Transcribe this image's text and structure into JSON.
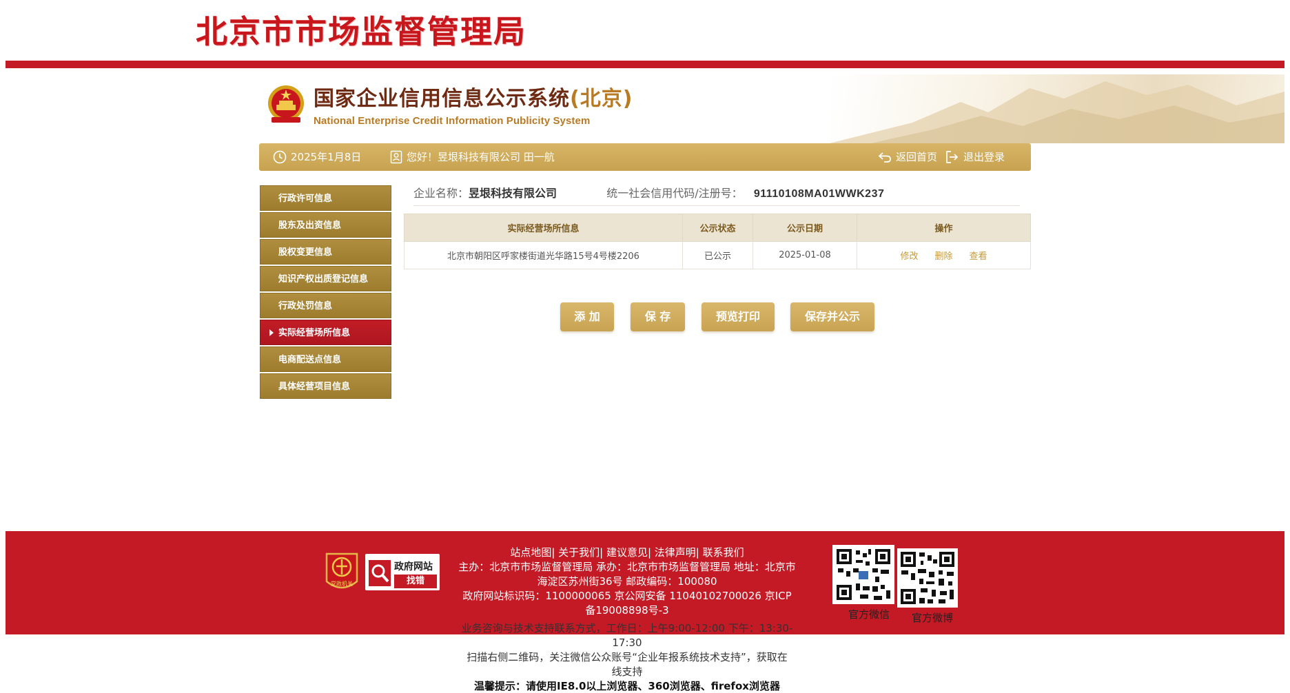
{
  "bureau": {
    "title": "北京市市场监督管理局"
  },
  "system": {
    "title_cn": "国家企业信用信息公示系统",
    "title_paren": "(北京)",
    "title_en": "National Enterprise Credit Information Publicity System"
  },
  "info_bar": {
    "date": "2025年1月8日",
    "greeting": "您好！昱垠科技有限公司  田一航",
    "home_link": "返回首页",
    "logout_link": "退出登录"
  },
  "sidebar": {
    "items": [
      {
        "label": "行政许可信息",
        "active": false
      },
      {
        "label": "股东及出资信息",
        "active": false
      },
      {
        "label": "股权变更信息",
        "active": false
      },
      {
        "label": "知识产权出质登记信息",
        "active": false
      },
      {
        "label": "行政处罚信息",
        "active": false
      },
      {
        "label": "实际经营场所信息",
        "active": true
      },
      {
        "label": "电商配送点信息",
        "active": false
      },
      {
        "label": "具体经营项目信息",
        "active": false
      }
    ]
  },
  "company": {
    "name_label": "企业名称：",
    "name": "昱垠科技有限公司",
    "code_label": "统一社会信用代码/注册号：",
    "code": "91110108MA01WWK237"
  },
  "table": {
    "headers": [
      "实际经营场所信息",
      "公示状态",
      "公示日期",
      "操作"
    ],
    "rows": [
      {
        "address": "北京市朝阳区呼家楼街道光华路15号4号楼2206",
        "status": "已公示",
        "date": "2025-01-08",
        "actions": [
          "修改",
          "删除",
          "查看"
        ]
      }
    ]
  },
  "buttons": {
    "add": "添 加",
    "save": "保 存",
    "preview": "预览打印",
    "save_publish": "保存并公示"
  },
  "footer": {
    "links": "站点地图| 关于我们| 建议意见| 法律声明| 联系我们",
    "host_line1": "主办：北京市市场监督管理局 承办：北京市市场监督管理局 地址：北京市",
    "host_line2": "海淀区苏州街36号 邮政编码：100080",
    "ids_line1": "政府网站标识码：1100000065     京公网安备 11040102700026     京ICP",
    "ids_line2": "备19008898号-3",
    "support_line1": "业务咨询与技术支持联系方式，工作日：上午9:00-12:00 下午：13:30-",
    "support_line2": "17:30",
    "wechat_line1": "扫描右侧二维码，关注微信公众账号“企业年报系统技术支持”，获取在",
    "wechat_line2": "线支持",
    "browser_tip": "温馨提示：请使用IE8.0以上浏览器、360浏览器、firefox浏览器",
    "badge_party": "党政机关",
    "gov_badge_top": "政府网站",
    "gov_badge_bottom": "找错",
    "qr_wechat_caption": "官方微信",
    "qr_weibo_caption": "官方微博"
  },
  "colors": {
    "brand_red": "#c31a25",
    "gold": "#c9a453",
    "sidebar_gold": "#a7853a",
    "active_red": "#b81a22"
  }
}
